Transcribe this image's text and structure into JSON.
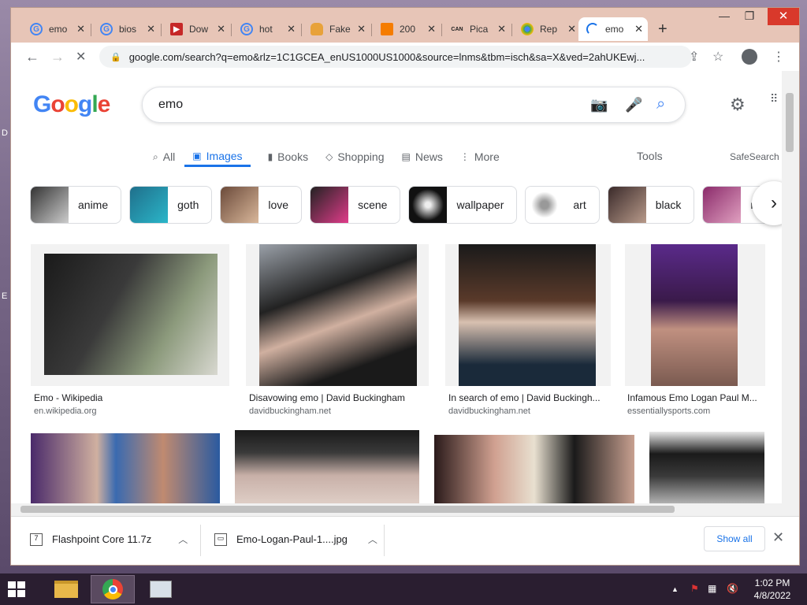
{
  "desktop": {
    "marks": [
      "D",
      "E"
    ]
  },
  "tabs": [
    {
      "label": "emo",
      "favicon": "google-icon",
      "active": false
    },
    {
      "label": "bios",
      "favicon": "google-icon",
      "active": false
    },
    {
      "label": "Dow",
      "favicon": "download-site-icon",
      "active": false
    },
    {
      "label": "hot",
      "favicon": "google-icon",
      "active": false
    },
    {
      "label": "Fake",
      "favicon": "burger-icon",
      "active": false
    },
    {
      "label": "200",
      "favicon": "orange-site-icon",
      "active": false
    },
    {
      "label": "Pica",
      "favicon": "cancan-icon",
      "active": false
    },
    {
      "label": "Rep",
      "favicon": "replit-icon",
      "active": false
    },
    {
      "label": "emo",
      "favicon": "loading-spinner-icon",
      "active": true
    }
  ],
  "toolbar": {
    "url": "google.com/search?q=emo&rlz=1C1GCEA_enUS1000US1000&source=lnms&tbm=isch&sa=X&ved=2ahUKEwj..."
  },
  "search": {
    "logo": "Google",
    "query": "emo",
    "nav_tabs": [
      {
        "label": "All",
        "icon": "search-icon",
        "active": false
      },
      {
        "label": "Images",
        "icon": "image-icon",
        "active": true
      },
      {
        "label": "Books",
        "icon": "book-icon",
        "active": false
      },
      {
        "label": "Shopping",
        "icon": "tag-icon",
        "active": false
      },
      {
        "label": "News",
        "icon": "news-icon",
        "active": false
      },
      {
        "label": "More",
        "icon": "more-vert-icon",
        "active": false
      }
    ],
    "tools": "Tools",
    "safesearch": "SafeSearch",
    "chips": [
      "anime",
      "goth",
      "love",
      "scene",
      "wallpaper",
      "art",
      "black",
      "my"
    ],
    "results": [
      {
        "title": "Emo - Wikipedia",
        "site": "en.wikipedia.org"
      },
      {
        "title": "Disavowing emo | David Buckingham",
        "site": "davidbuckingham.net"
      },
      {
        "title": "In search of emo | David Buckingh...",
        "site": "davidbuckingham.net"
      },
      {
        "title": "Infamous Emo Logan Paul M...",
        "site": "essentiallysports.com"
      }
    ]
  },
  "downloads": {
    "items": [
      {
        "name": "Flashpoint Core 11.7z"
      },
      {
        "name": "Emo-Logan-Paul-1....jpg"
      }
    ],
    "show_all": "Show all"
  },
  "taskbar": {
    "time": "1:02 PM",
    "date": "4/8/2022"
  },
  "colors": {
    "accent": "#1a73e8",
    "window_frame": "#e7c5b7",
    "close": "#d9392b"
  }
}
